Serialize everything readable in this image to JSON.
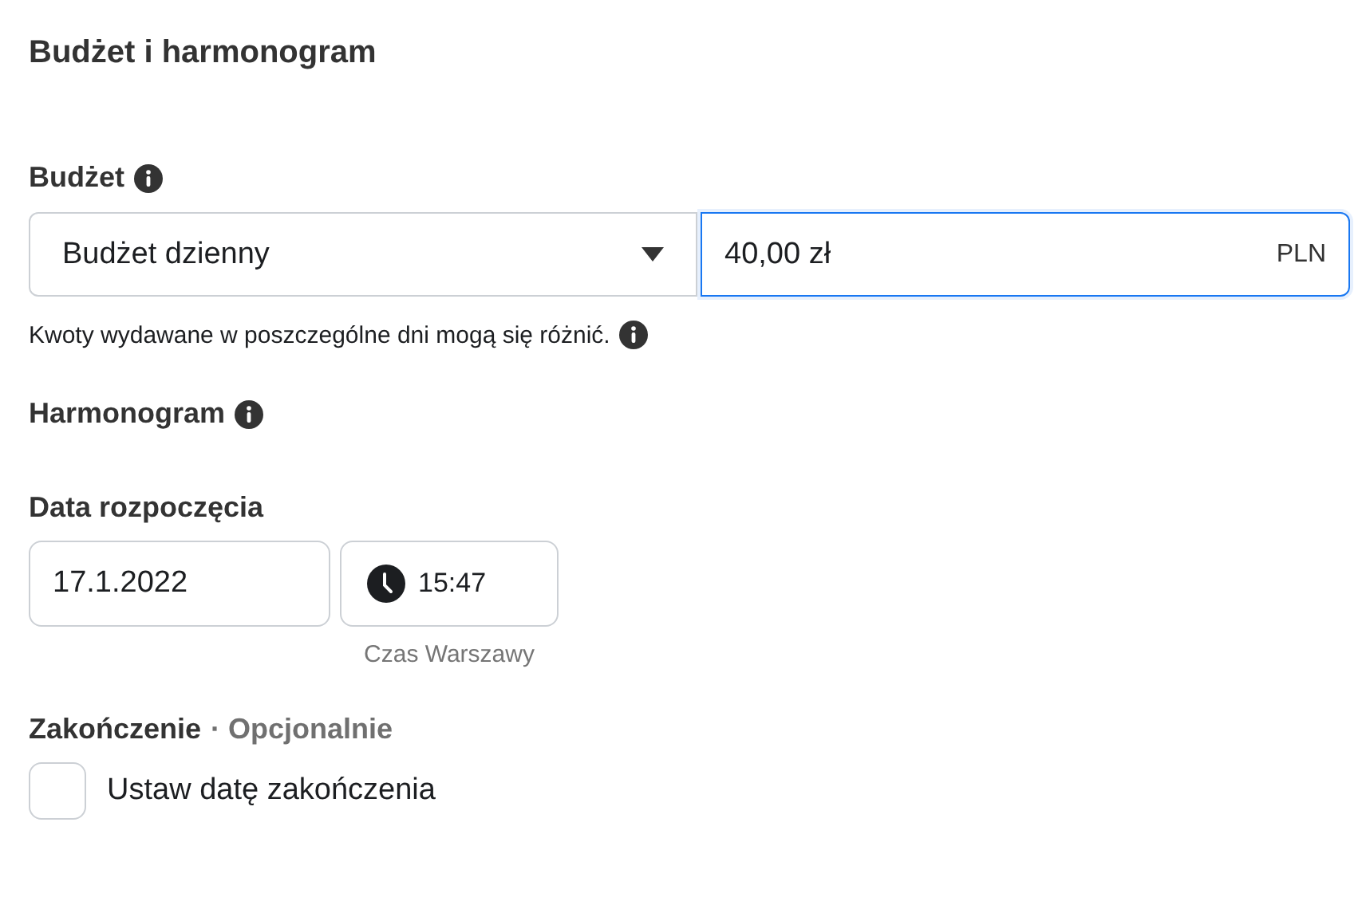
{
  "title": "Budżet i harmonogram",
  "budget": {
    "label": "Budżet",
    "type": {
      "value": "Budżet dzienny"
    },
    "amount": {
      "value": "40,00 zł",
      "currency": "PLN",
      "focused": true
    },
    "note": "Kwoty wydawane w poszczególne dni mogą się różnić."
  },
  "schedule": {
    "label": "Harmonogram"
  },
  "start": {
    "label": "Data rozpoczęcia",
    "date": "17.1.2022",
    "time": "15:47",
    "timezone": "Czas Warszawy"
  },
  "end": {
    "label": "Zakończenie",
    "optional": "· Opcjonalnie",
    "checkbox": {
      "label": "Ustaw datę zakończenia",
      "checked": false
    }
  }
}
